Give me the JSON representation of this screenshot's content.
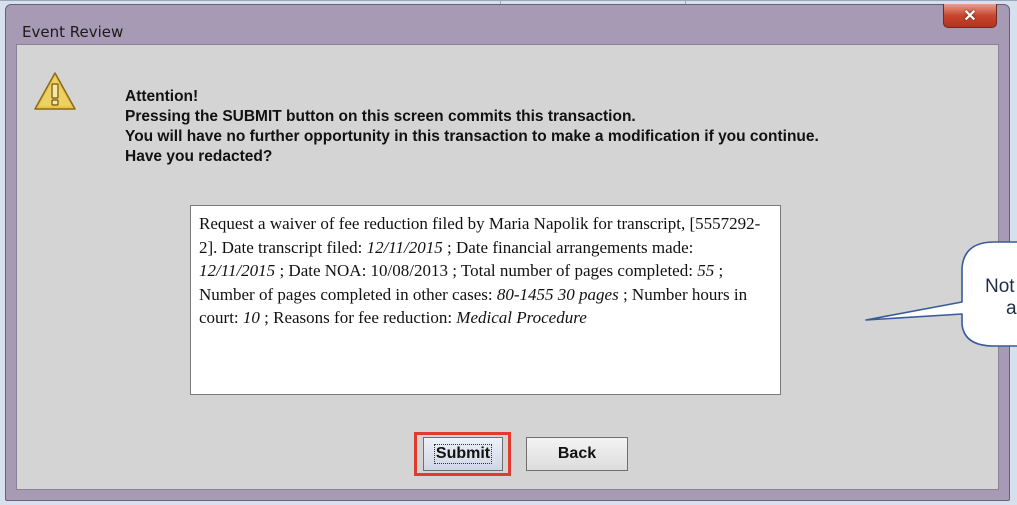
{
  "window": {
    "title": "Event Review",
    "close_glyph": "✕"
  },
  "message": {
    "lines": [
      "Attention!",
      "Pressing the SUBMIT button on this screen commits this transaction.",
      "You will have no further opportunity in this transaction to make a modification if you continue.",
      "Have you redacted?"
    ]
  },
  "description": {
    "p1": "Request a waiver of fee reduction filed by Maria Napolik for transcript, [5557292-2]. Date transcript filed: ",
    "date_filed": "12/11/2015",
    "p2": " ; Date financial arrangements made: ",
    "date_arrangements": "12/11/2015",
    "p3": " ; Date NOA: 10/08/2013 ; Total number of pages completed: ",
    "pages_completed": "55",
    "p4": " ; Number of pages completed in other cases: ",
    "other_cases": "80-1455 30 pages",
    "p5": " ; Number hours in court: ",
    "hours": "10",
    "p6": " ; Reasons for fee reduction: ",
    "reason": "Medical Procedure"
  },
  "buttons": {
    "submit": "Submit",
    "back": "Back"
  },
  "callout": {
    "line1": "Not",
    "line2": "a"
  },
  "colors": {
    "highlight": "#e23b2e",
    "callout_border": "#3a5a9a"
  },
  "icons": {
    "warning": "warning-icon"
  }
}
